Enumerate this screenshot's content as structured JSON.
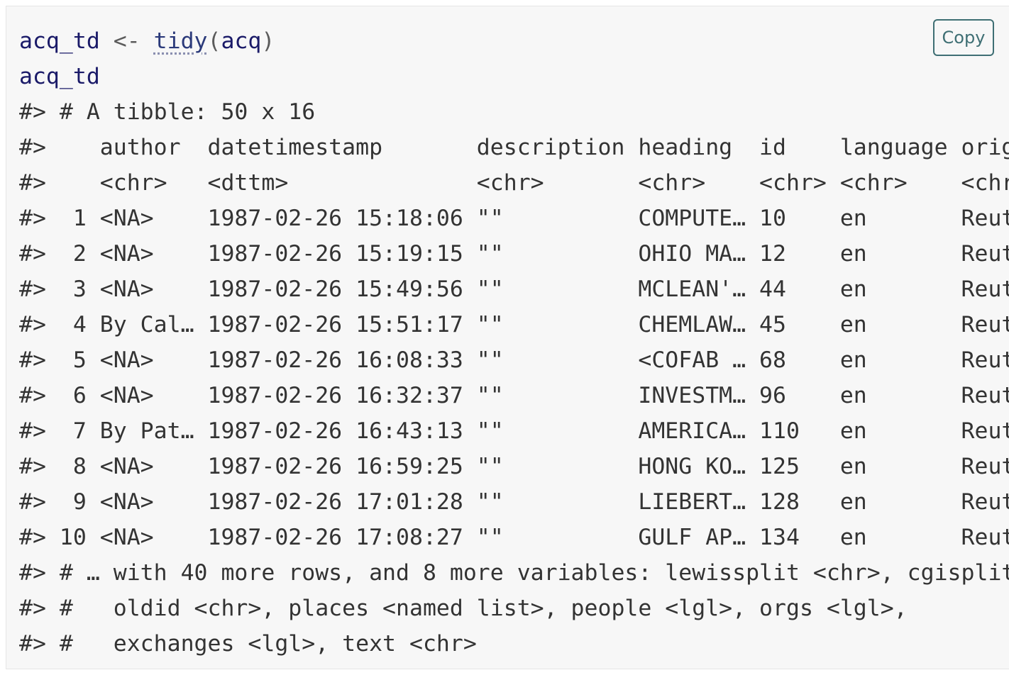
{
  "code_block": {
    "input_lines": [
      {
        "var": "acq_td",
        "op": " <- ",
        "fn": "tidy",
        "open": "(",
        "arg": "acq",
        "close": ")"
      },
      {
        "var": "acq_td"
      }
    ],
    "output_lines": [
      "#> # A tibble: 50 x 16",
      "#>    author  datetimestamp       description heading  id    language orig",
      "#>    <chr>   <dttm>              <chr>       <chr>    <chr> <chr>    <chr",
      "#>  1 <NA>    1987-02-26 15:18:06 \"\"          COMPUTE… 10    en       Reut",
      "#>  2 <NA>    1987-02-26 15:19:15 \"\"          OHIO MA… 12    en       Reut",
      "#>  3 <NA>    1987-02-26 15:49:56 \"\"          MCLEAN'… 44    en       Reut",
      "#>  4 By Cal… 1987-02-26 15:51:17 \"\"          CHEMLAW… 45    en       Reut",
      "#>  5 <NA>    1987-02-26 16:08:33 \"\"          <COFAB … 68    en       Reut",
      "#>  6 <NA>    1987-02-26 16:32:37 \"\"          INVESTM… 96    en       Reut",
      "#>  7 By Pat… 1987-02-26 16:43:13 \"\"          AMERICA… 110   en       Reut",
      "#>  8 <NA>    1987-02-26 16:59:25 \"\"          HONG KO… 125   en       Reut",
      "#>  9 <NA>    1987-02-26 17:01:28 \"\"          LIEBERT… 128   en       Reut",
      "#> 10 <NA>    1987-02-26 17:08:27 \"\"          GULF AP… 134   en       Reut",
      "#> # … with 40 more rows, and 8 more variables: lewissplit <chr>, cgisplit",
      "#> #   oldid <chr>, places <named list>, people <lgl>, orgs <lgl>,",
      "#> #   exchanges <lgl>, text <chr>"
    ]
  },
  "copy_button": {
    "label": "Copy"
  },
  "colors": {
    "background": "#f7f7f7",
    "code_variable": "#1a1a68",
    "output_text": "#333333",
    "copy_button_border": "#3f6f74"
  }
}
